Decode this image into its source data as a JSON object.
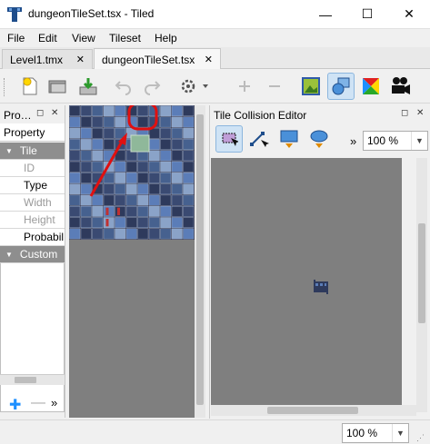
{
  "window": {
    "title": "dungeonTileSet.tsx - Tiled",
    "controls": {
      "minimize": "—",
      "maximize": "☐",
      "close": "✕"
    }
  },
  "menu": [
    "File",
    "Edit",
    "View",
    "Tileset",
    "Help"
  ],
  "tabs": [
    {
      "label": "Level1.tmx",
      "active": false
    },
    {
      "label": "dungeonTileSet.tsx",
      "active": true
    }
  ],
  "tab_close": "✕",
  "toolbar_icons": [
    "new-file-icon",
    "open-folder-icon",
    "save-icon",
    "undo-icon",
    "redo-icon",
    "settings-icon",
    "add-icon",
    "remove-icon",
    "tileset-image-icon",
    "collision-shapes-icon",
    "terrain-icon",
    "camera-icon"
  ],
  "properties": {
    "title": "Pro…",
    "header": "Property",
    "rows": [
      {
        "label": "Tile",
        "kind": "group"
      },
      {
        "label": "ID",
        "kind": "item",
        "disabled": true
      },
      {
        "label": "Type",
        "kind": "item",
        "disabled": false
      },
      {
        "label": "Width",
        "kind": "item",
        "disabled": true
      },
      {
        "label": "Height",
        "kind": "item",
        "disabled": true
      },
      {
        "label": "Probabil",
        "kind": "item",
        "disabled": false
      },
      {
        "label": "Custom",
        "kind": "group"
      }
    ],
    "footer_more": "»"
  },
  "dock_buttons": {
    "float": "◻",
    "close": "✕"
  },
  "collision_editor": {
    "title": "Tile Collision Editor",
    "more": "»",
    "zoom": "100 %"
  },
  "status": {
    "zoom": "100 %"
  },
  "colors": {
    "highlight": "#e01010",
    "tile": "#2e3a5c",
    "accent": "#1e90ff"
  }
}
